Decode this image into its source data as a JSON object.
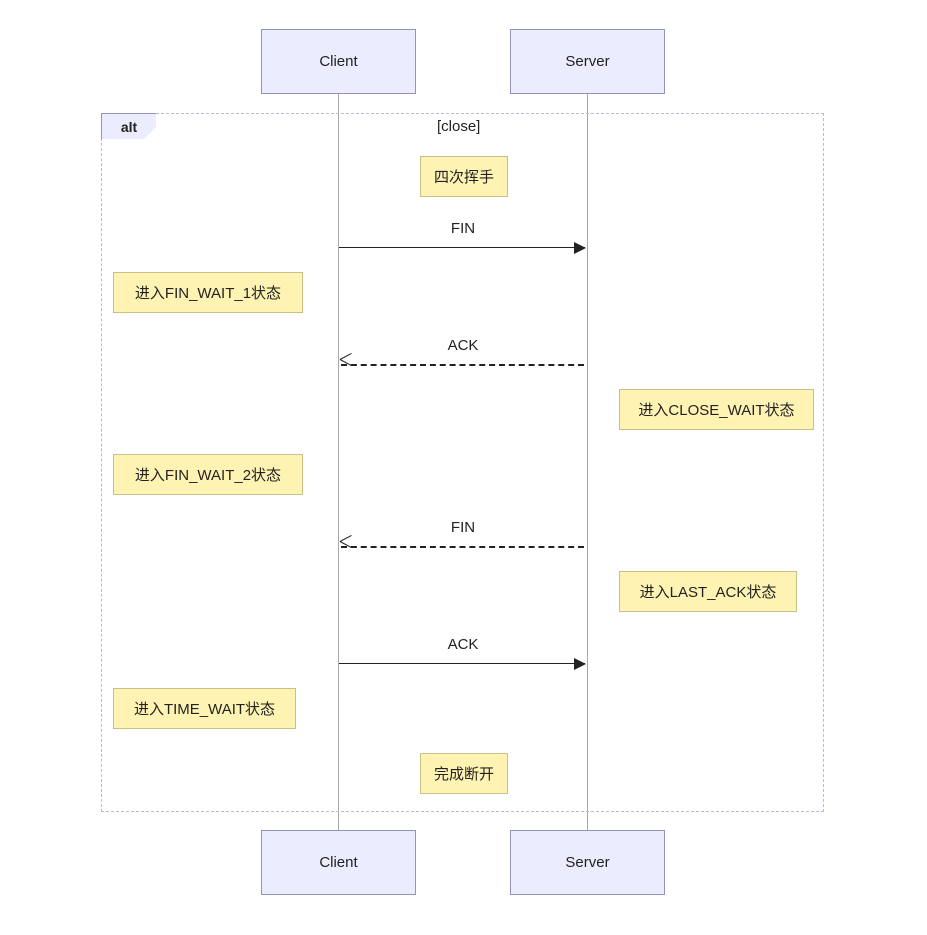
{
  "actors": {
    "client": "Client",
    "server": "Server"
  },
  "alt": {
    "label": "alt",
    "condition": "[close]"
  },
  "notes": {
    "title": "四次挥手",
    "fin_wait_1": "进入FIN_WAIT_1状态",
    "close_wait": "进入CLOSE_WAIT状态",
    "fin_wait_2": "进入FIN_WAIT_2状态",
    "last_ack": "进入LAST_ACK状态",
    "time_wait": "进入TIME_WAIT状态",
    "done": "完成断开"
  },
  "messages": {
    "fin1": "FIN",
    "ack1": "ACK",
    "fin2": "FIN",
    "ack2": "ACK"
  },
  "colors": {
    "actor_fill": "#ececff",
    "actor_border": "#9393c2",
    "note_fill": "#fff3b3",
    "note_border": "#c8c187",
    "dash": "#b9b9d6"
  }
}
